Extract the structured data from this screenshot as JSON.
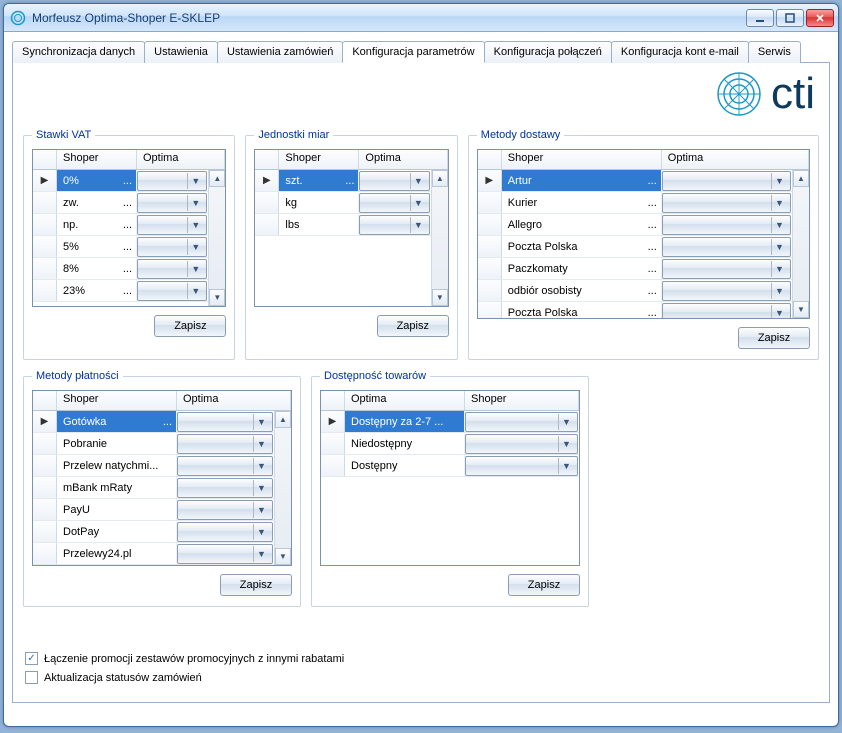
{
  "window": {
    "title": "Morfeusz Optima-Shoper E-SKLEP"
  },
  "brand": {
    "word": "cti"
  },
  "tabs": [
    {
      "label": "Synchronizacja danych"
    },
    {
      "label": "Ustawienia"
    },
    {
      "label": "Ustawienia zamówień"
    },
    {
      "label": "Konfiguracja parametrów"
    },
    {
      "label": "Konfiguracja połączeń"
    },
    {
      "label": "Konfiguracja kont e-mail"
    },
    {
      "label": "Serwis"
    }
  ],
  "active_tab_label": "Konfiguracja parametrów",
  "common": {
    "save_label": "Zapisz",
    "col_shoper": "Shoper",
    "col_optima": "Optima",
    "ellipsis": "..."
  },
  "groups": {
    "vat": {
      "legend": "Stawki VAT",
      "rows": [
        {
          "shoper": "0%"
        },
        {
          "shoper": "zw."
        },
        {
          "shoper": "np."
        },
        {
          "shoper": "5%"
        },
        {
          "shoper": "8%"
        },
        {
          "shoper": "23%"
        }
      ]
    },
    "units": {
      "legend": "Jednostki miar",
      "rows": [
        {
          "shoper": "szt."
        },
        {
          "shoper": "kg"
        },
        {
          "shoper": "lbs"
        }
      ]
    },
    "shipping": {
      "legend": "Metody dostawy",
      "rows": [
        {
          "shoper": "Artur"
        },
        {
          "shoper": "Kurier"
        },
        {
          "shoper": "Allegro"
        },
        {
          "shoper": "Poczta Polska"
        },
        {
          "shoper": "Paczkomaty"
        },
        {
          "shoper": "odbiór osobisty"
        },
        {
          "shoper": "Poczta Polska"
        }
      ]
    },
    "payment": {
      "legend": "Metody płatności",
      "rows": [
        {
          "shoper": "Gotówka"
        },
        {
          "shoper": "Pobranie"
        },
        {
          "shoper": "Przelew natychmi..."
        },
        {
          "shoper": "mBank mRaty"
        },
        {
          "shoper": "PayU"
        },
        {
          "shoper": "DotPay"
        },
        {
          "shoper": "Przelewy24.pl"
        }
      ]
    },
    "availability": {
      "legend": "Dostępność towarów",
      "rows": [
        {
          "optima": "Dostępny za 2-7 ..."
        },
        {
          "optima": "Niedostępny"
        },
        {
          "optima": "Dostępny"
        }
      ]
    }
  },
  "checks": {
    "promo": {
      "label": "Łączenie promocji zestawów promocyjnych z innymi rabatami",
      "checked": true
    },
    "status": {
      "label": "Aktualizacja statusów zamówień",
      "checked": false
    }
  }
}
